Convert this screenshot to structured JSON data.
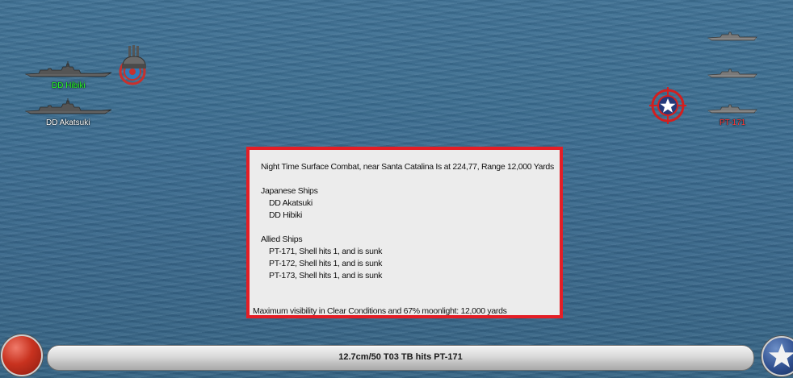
{
  "colors": {
    "sea": "#3b6b8f",
    "dialog_border": "#e41e26",
    "japanese_label": "#ffffff",
    "japanese_active_label": "#27ff27",
    "allied_label": "#ff3b3b"
  },
  "japanese_ships": [
    {
      "label": "DD Hibiki",
      "icon": "destroyer-silhouette-icon",
      "active": true
    },
    {
      "label": "DD Akatsuki",
      "icon": "destroyer-silhouette-icon",
      "active": false
    }
  ],
  "allied_ships": [
    {
      "label": "",
      "icon": "pt-boat-silhouette-icon"
    },
    {
      "label": "",
      "icon": "pt-boat-silhouette-icon"
    },
    {
      "label": "PT-171",
      "icon": "pt-boat-silhouette-icon"
    }
  ],
  "markers": {
    "japanese_turret": "gun-turret-icon",
    "japanese_target": "target-icon",
    "allied_target": "us-star-target-icon"
  },
  "dialog": {
    "line1": "Night Time Surface Combat, near Santa Catalina Is at 224,77, Range 12,000 Yards",
    "jp_header": "Japanese Ships",
    "jp_ships": [
      "DD Akatsuki",
      "DD Hibiki"
    ],
    "al_header": "Allied Ships",
    "al_ships": [
      "PT-171, Shell hits 1, and is sunk",
      "PT-172, Shell hits 1, and is sunk",
      "PT-173, Shell hits 1, and is sunk"
    ],
    "footer": "Maximum visibility in Clear Conditions and 67% moonlight: 12,000 yards"
  },
  "status_bar": {
    "message": "12.7cm/50 T03 TB hits PT-171",
    "left_button_icon": "red-circle-icon",
    "right_button_icon": "white-star-icon"
  }
}
